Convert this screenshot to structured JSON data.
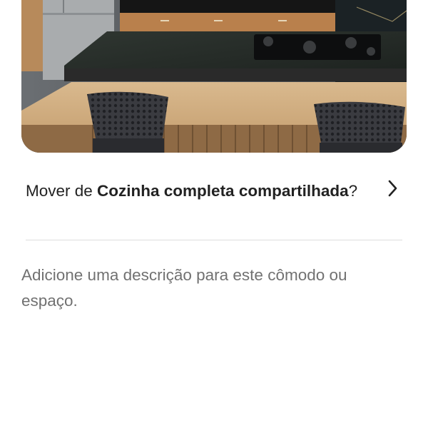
{
  "photo": {
    "subject": "kitchen-counter-photo"
  },
  "move_prompt": {
    "prefix": "Mover de ",
    "room_bold": "Cozinha completa compartilhada",
    "suffix": "?",
    "chevron_icon": "chevron-right-icon"
  },
  "description": {
    "placeholder": "Adicione uma descrição para este cômodo ou espaço."
  },
  "colors": {
    "text_primary": "#222222",
    "text_secondary": "#717171",
    "divider": "#dddddd"
  }
}
